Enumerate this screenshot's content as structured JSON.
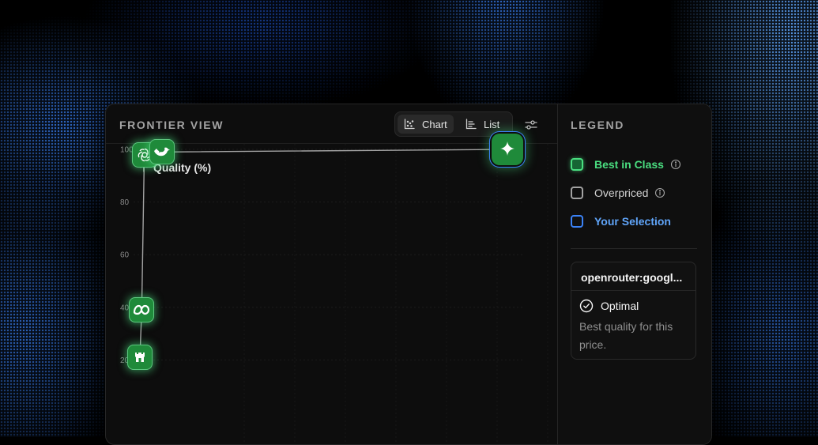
{
  "header": {
    "title": "FRONTIER VIEW",
    "view_toggle": [
      {
        "label": "Chart",
        "icon": "scatter-chart-icon",
        "active": true
      },
      {
        "label": "List",
        "icon": "bar-list-icon",
        "active": false
      }
    ],
    "settings_icon": "sliders-icon"
  },
  "chart_data": {
    "type": "scatter",
    "ylabel": "Quality (%)",
    "ylim": [
      0,
      100
    ],
    "yticks": [
      20,
      40,
      60,
      80,
      100
    ],
    "grid": true,
    "points": [
      {
        "x": 0.0,
        "y": 21,
        "icon": "castle-logo-icon"
      },
      {
        "x": 0.005,
        "y": 39,
        "icon": "meta-logo-icon"
      },
      {
        "x": 0.012,
        "y": 98,
        "icon": "openai-logo-icon"
      },
      {
        "x": 0.06,
        "y": 99,
        "icon": "deepseek-whale-icon"
      },
      {
        "x": 1.0,
        "y": 100,
        "icon": "gemini-sparkle-icon",
        "selected": true
      }
    ]
  },
  "legend": {
    "title": "LEGEND",
    "items": [
      {
        "label": "Best in Class",
        "color": "#4ade80",
        "info": true
      },
      {
        "label": "Overpriced",
        "color": "#d4d4d4",
        "info": true
      },
      {
        "label": "Your Selection",
        "color": "#60a5fa",
        "info": false
      }
    ],
    "selection_card": {
      "model": "openrouter:googl...",
      "status": "Optimal",
      "description": "Best quality for this price."
    }
  },
  "colors": {
    "accent_green": "#4ade80",
    "node_green": "#1f8a3a",
    "selection_blue": "#3b82f6",
    "panel_bg": "#0d0d0d"
  }
}
